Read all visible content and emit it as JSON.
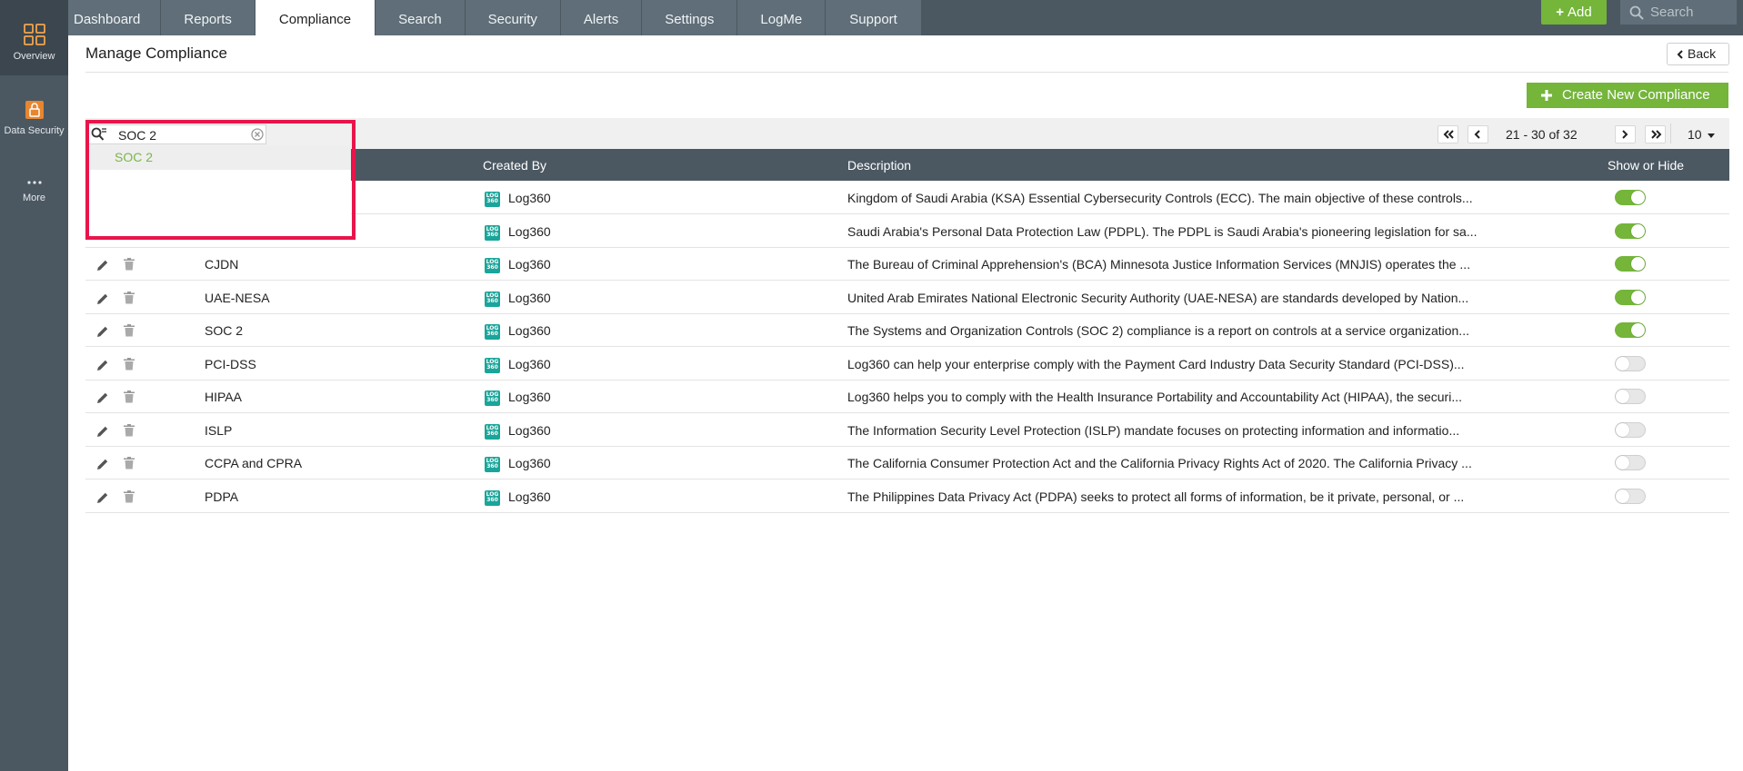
{
  "rail": {
    "items": [
      {
        "label": "Overview",
        "icon": "grid-icon"
      },
      {
        "label": "Data Security",
        "icon": "data-security-icon"
      },
      {
        "label": "More",
        "icon": "more-dots-icon"
      }
    ]
  },
  "nav": {
    "tabs": [
      {
        "label": "Dashboard"
      },
      {
        "label": "Reports"
      },
      {
        "label": "Compliance",
        "active": true
      },
      {
        "label": "Search"
      },
      {
        "label": "Security"
      },
      {
        "label": "Alerts"
      },
      {
        "label": "Settings"
      },
      {
        "label": "LogMe"
      },
      {
        "label": "Support"
      }
    ],
    "add_label": "Add",
    "search_placeholder": "Search"
  },
  "page": {
    "title": "Manage Compliance",
    "back_label": "Back",
    "create_label": "Create New Compliance"
  },
  "filter": {
    "value": "SOC 2",
    "suggestions": [
      "SOC 2"
    ]
  },
  "pager": {
    "range_text": "21 - 30 of 32",
    "page_size": "10"
  },
  "table": {
    "headers": {
      "created_by": "Created By",
      "description": "Description",
      "show_hide": "Show or Hide"
    },
    "rows": [
      {
        "name": "",
        "created_by": "Log360",
        "description": "Kingdom of Saudi Arabia (KSA) Essential Cybersecurity Controls (ECC). The main objective of these controls...",
        "shown": true,
        "actions": false
      },
      {
        "name": "",
        "created_by": "Log360",
        "description": "Saudi Arabia's Personal Data Protection Law (PDPL). The PDPL is Saudi Arabia's pioneering legislation for sa...",
        "shown": true,
        "actions": false
      },
      {
        "name": "CJDN",
        "created_by": "Log360",
        "description": "The Bureau of Criminal Apprehension's (BCA) Minnesota Justice Information Services (MNJIS) operates the ...",
        "shown": true,
        "actions": true
      },
      {
        "name": "UAE-NESA",
        "created_by": "Log360",
        "description": "United Arab Emirates National Electronic Security Authority (UAE-NESA) are standards developed by Nation...",
        "shown": true,
        "actions": true
      },
      {
        "name": "SOC 2",
        "created_by": "Log360",
        "description": "The Systems and Organization Controls (SOC 2) compliance is a report on controls at a service organization...",
        "shown": true,
        "actions": true
      },
      {
        "name": "PCI-DSS",
        "created_by": "Log360",
        "description": "Log360 can help your enterprise comply with the Payment Card Industry Data Security Standard (PCI-DSS)...",
        "shown": false,
        "actions": true
      },
      {
        "name": "HIPAA",
        "created_by": "Log360",
        "description": "Log360 helps you to comply with the Health Insurance Portability and Accountability Act (HIPAA), the securi...",
        "shown": false,
        "actions": true
      },
      {
        "name": "ISLP",
        "created_by": "Log360",
        "description": "The Information Security Level Protection (ISLP) mandate focuses on protecting information and informatio...",
        "shown": false,
        "actions": true
      },
      {
        "name": "CCPA and CPRA",
        "created_by": "Log360",
        "description": "The California Consumer Protection Act and the California Privacy Rights Act of 2020. The California Privacy ...",
        "shown": false,
        "actions": true
      },
      {
        "name": "PDPA",
        "created_by": "Log360",
        "description": "The Philippines Data Privacy Act (PDPA) seeks to protect all forms of information, be it private, personal, or ...",
        "shown": false,
        "actions": true
      }
    ]
  },
  "colors": {
    "nav_bg": "#4b5862",
    "accent_green": "#74b53a",
    "highlight_border": "#e8154b",
    "logo_teal": "#1aa59a"
  }
}
